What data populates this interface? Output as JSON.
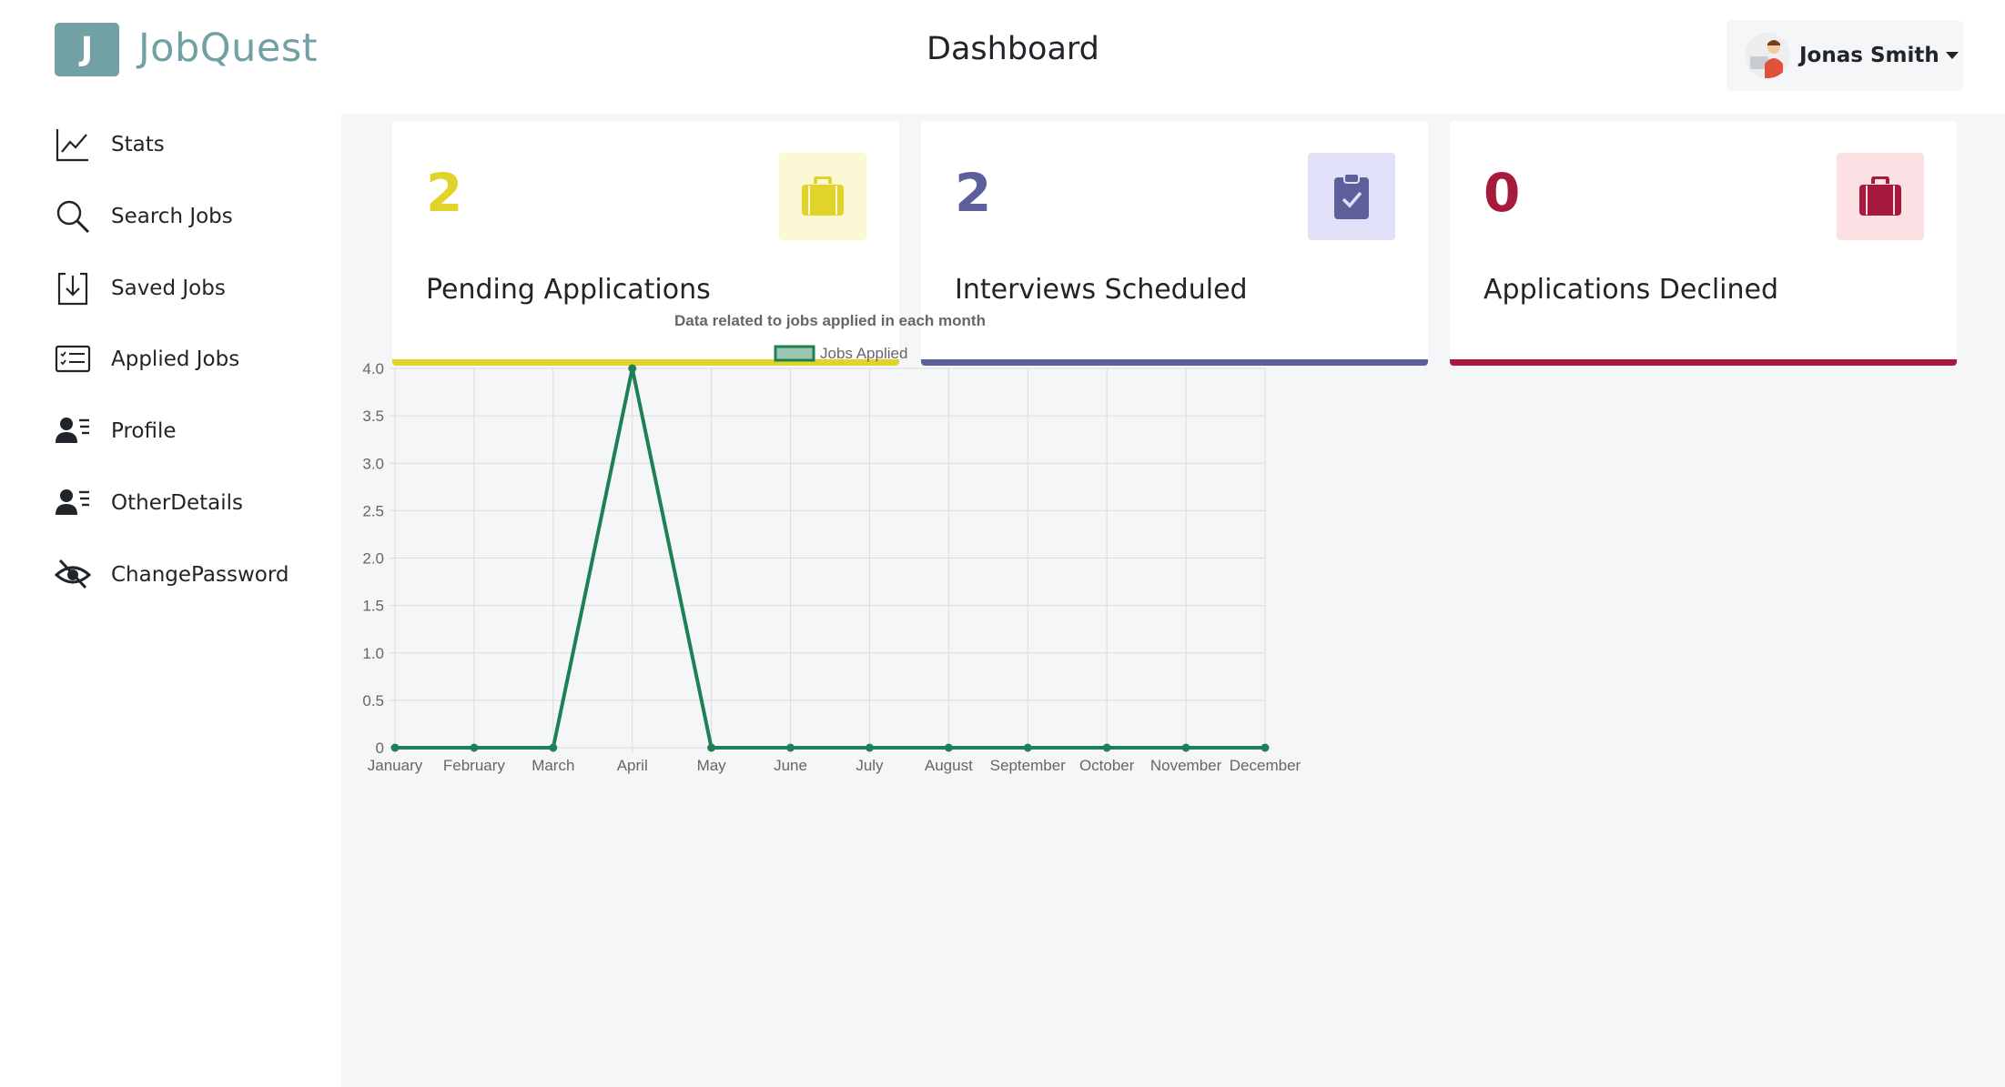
{
  "app": {
    "logo_letter": "J",
    "name": "JobQuest"
  },
  "header": {
    "title": "Dashboard",
    "user_name": "Jonas Smith"
  },
  "sidebar": {
    "items": [
      {
        "label": "Stats",
        "icon": "line-chart-icon"
      },
      {
        "label": "Search Jobs",
        "icon": "search-icon"
      },
      {
        "label": "Saved Jobs",
        "icon": "save-download-icon"
      },
      {
        "label": "Applied Jobs",
        "icon": "list-card-icon"
      },
      {
        "label": "Profile",
        "icon": "user-list-icon"
      },
      {
        "label": "OtherDetails",
        "icon": "user-list-icon"
      },
      {
        "label": "ChangePassword",
        "icon": "eye-slash-icon"
      }
    ]
  },
  "stats": [
    {
      "value": "2",
      "label": "Pending Applications",
      "color": "#e2d32a",
      "bg": "#fcf8d6",
      "icon": "briefcase-icon"
    },
    {
      "value": "2",
      "label": "Interviews Scheduled",
      "color": "#5d5f9b",
      "bg": "#e0e0f9",
      "icon": "clipboard-check-icon"
    },
    {
      "value": "0",
      "label": "Applications Declined",
      "color": "#a8193e",
      "bg": "#fbe1e4",
      "icon": "briefcase-icon"
    }
  ],
  "chart_data": {
    "type": "line",
    "title": "Data related to jobs applied in each month",
    "categories": [
      "January",
      "February",
      "March",
      "April",
      "May",
      "June",
      "July",
      "August",
      "September",
      "October",
      "November",
      "December"
    ],
    "series": [
      {
        "name": "Jobs Applied",
        "values": [
          0,
          0,
          0,
          4,
          0,
          0,
          0,
          0,
          0,
          0,
          0,
          0
        ],
        "color": "#1e8155"
      }
    ],
    "ylim": [
      0,
      4
    ],
    "yticks": [
      "0",
      "0.5",
      "1.0",
      "1.5",
      "2.0",
      "2.5",
      "3.0",
      "3.5",
      "4.0"
    ],
    "grid": true,
    "legend": "top"
  }
}
